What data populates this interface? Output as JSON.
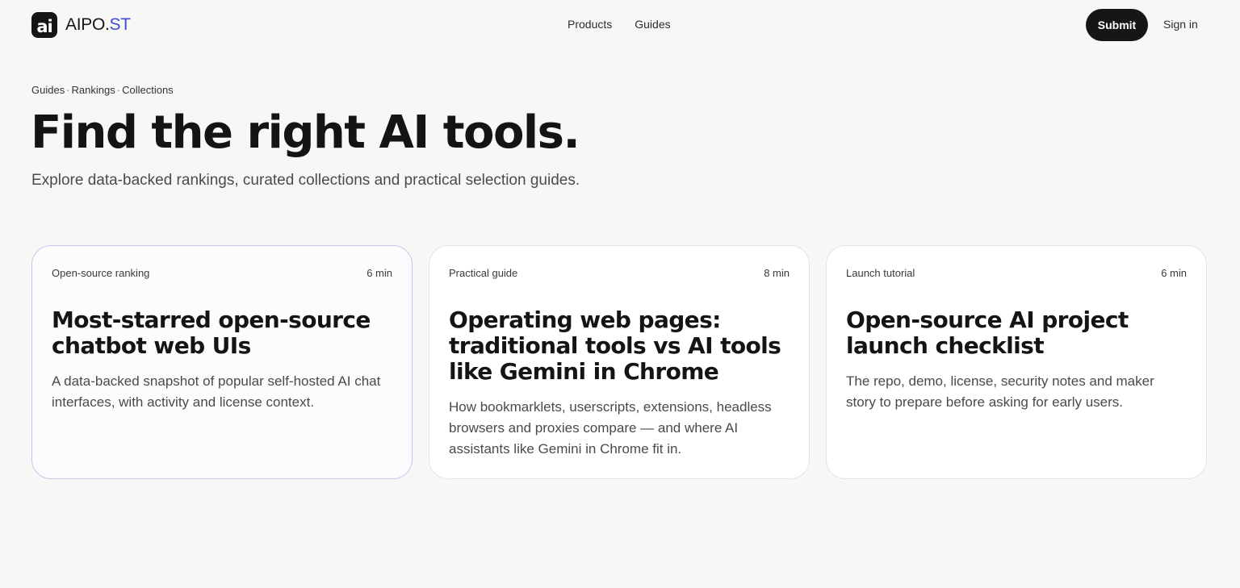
{
  "header": {
    "logo_mark": "ai",
    "logo_text_main": "AIPO.",
    "logo_text_accent": "ST",
    "nav": [
      "Products",
      "Guides"
    ],
    "submit_label": "Submit",
    "signin_label": "Sign in"
  },
  "colors": {
    "background": "#f7f7f5",
    "accent": "#3d4bd1",
    "primary_button": "#161616",
    "active_card_border": "#c8c6ee"
  },
  "hero": {
    "breadcrumb": [
      "Guides",
      "Rankings",
      "Collections"
    ],
    "breadcrumb_separator": "·",
    "title": "Find the right AI tools.",
    "subtitle": "Explore data-backed rankings, curated collections and practical selection guides."
  },
  "cards": [
    {
      "category": "Open-source ranking",
      "read_time": "6 min",
      "title": "Most-starred open-source chatbot web UIs",
      "description": "A data-backed snapshot of popular self-hosted AI chat interfaces, with activity and license context."
    },
    {
      "category": "Practical guide",
      "read_time": "8 min",
      "title": "Operating web pages: traditional tools vs AI tools like Gemini in Chrome",
      "description": "How bookmarklets, userscripts, extensions, headless browsers and proxies compare — and where AI assistants like Gemini in Chrome fit in."
    },
    {
      "category": "Launch tutorial",
      "read_time": "6 min",
      "title": "Open-source AI project launch checklist",
      "description": "The repo, demo, license, security notes and maker story to prepare before asking for early users."
    }
  ]
}
